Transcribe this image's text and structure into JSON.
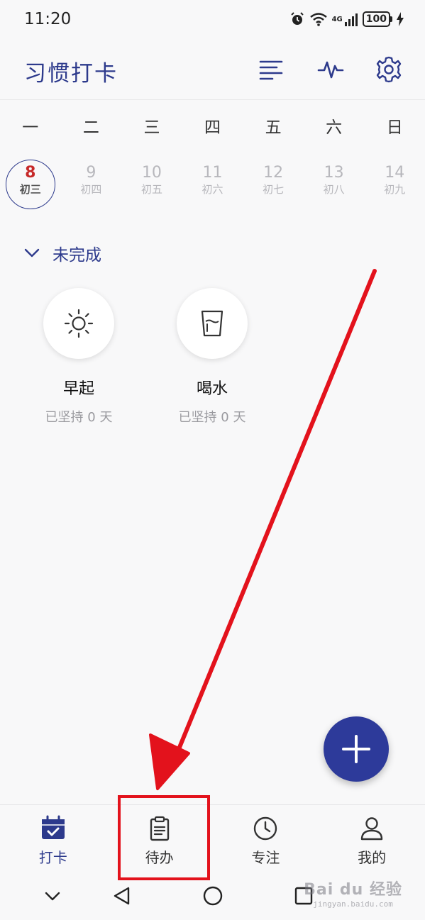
{
  "status_bar": {
    "time": "11:20",
    "network": "4G",
    "battery": "100",
    "icons": [
      "alarm-icon",
      "wifi-icon",
      "signal-icon",
      "battery-icon",
      "charging-icon"
    ]
  },
  "header": {
    "title": "习惯打卡",
    "actions": [
      "list-icon",
      "activity-icon",
      "settings-icon"
    ]
  },
  "calendar": {
    "weekdays": [
      "一",
      "二",
      "三",
      "四",
      "五",
      "六",
      "日"
    ],
    "dates": [
      {
        "day": "8",
        "lunar": "初三",
        "selected": true
      },
      {
        "day": "9",
        "lunar": "初四",
        "selected": false
      },
      {
        "day": "10",
        "lunar": "初五",
        "selected": false
      },
      {
        "day": "11",
        "lunar": "初六",
        "selected": false
      },
      {
        "day": "12",
        "lunar": "初七",
        "selected": false
      },
      {
        "day": "13",
        "lunar": "初八",
        "selected": false
      },
      {
        "day": "14",
        "lunar": "初九",
        "selected": false
      }
    ]
  },
  "section": {
    "title": "未完成",
    "habits": [
      {
        "name": "早起",
        "streak": "已坚持 0 天",
        "icon": "sun-icon"
      },
      {
        "name": "喝水",
        "streak": "已坚持 0 天",
        "icon": "cup-icon"
      }
    ]
  },
  "fab": {
    "icon": "plus-icon"
  },
  "bottom_nav": {
    "items": [
      {
        "label": "打卡",
        "icon": "calendar-check-icon",
        "active": true
      },
      {
        "label": "待办",
        "icon": "clipboard-icon",
        "active": false
      },
      {
        "label": "专注",
        "icon": "clock-icon",
        "active": false
      },
      {
        "label": "我的",
        "icon": "user-icon",
        "active": false
      }
    ]
  },
  "system_nav": [
    "chevron-down-icon",
    "back-icon",
    "home-icon",
    "recents-icon"
  ],
  "watermark": {
    "main": "Bai du 经验",
    "sub": "jingyan.baidu.com"
  },
  "colors": {
    "accent": "#2d3a8c",
    "fab": "#2d3a9a",
    "selected_day": "#c62828",
    "annotation": "#e3121c",
    "background": "#f8f8f9"
  }
}
